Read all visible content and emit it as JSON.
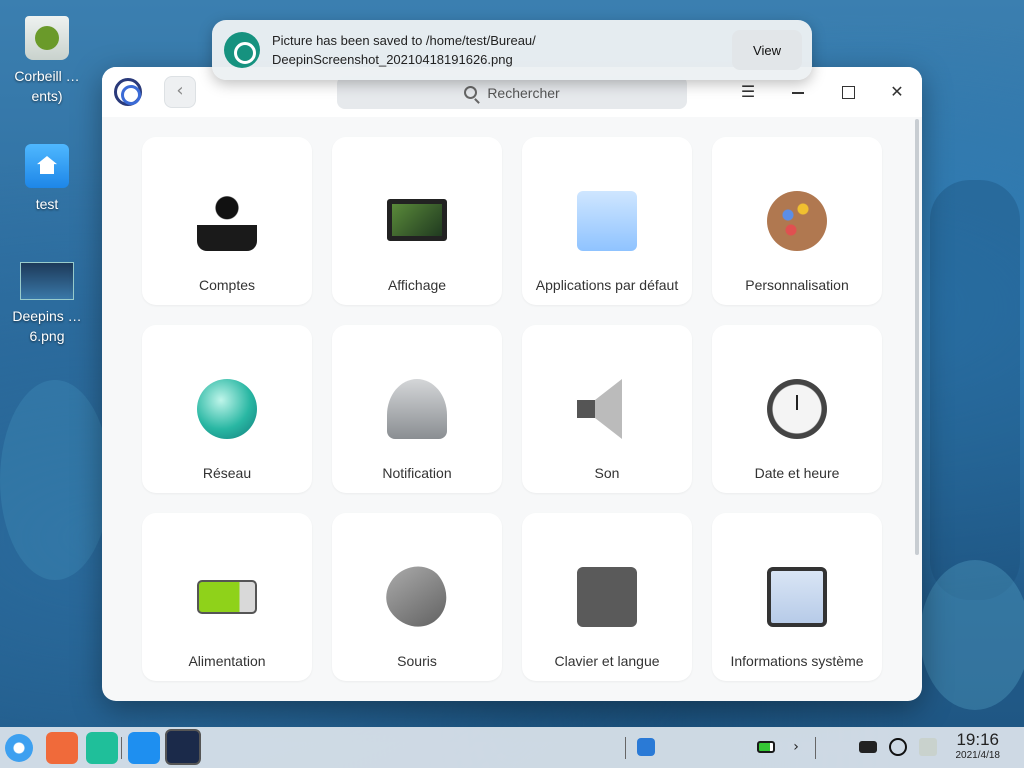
{
  "desktop": {
    "icons": [
      {
        "label": "Corbeill …ents)"
      },
      {
        "label": "test"
      },
      {
        "label": "Deepins …6.png"
      }
    ]
  },
  "notification": {
    "message_line1": "Picture has been saved to /home/test/Bureau/",
    "message_line2": "DeepinScreenshot_20210418191626.png",
    "button": "View"
  },
  "window": {
    "search_placeholder": "Rechercher",
    "back_glyph": "‹",
    "menu_glyph": "☰",
    "close_glyph": "✕",
    "modules": [
      {
        "label": "Comptes",
        "icon": "accounts-icon"
      },
      {
        "label": "Affichage",
        "icon": "display-icon"
      },
      {
        "label": "Applications par défaut",
        "icon": "default-apps-icon"
      },
      {
        "label": "Personnalisation",
        "icon": "personalization-icon"
      },
      {
        "label": "Réseau",
        "icon": "network-icon"
      },
      {
        "label": "Notification",
        "icon": "notification-bell-icon"
      },
      {
        "label": "Son",
        "icon": "speaker-icon"
      },
      {
        "label": "Date et heure",
        "icon": "clock-icon"
      },
      {
        "label": "Alimentation",
        "icon": "battery-icon"
      },
      {
        "label": "Souris",
        "icon": "mouse-icon"
      },
      {
        "label": "Clavier et langue",
        "icon": "keyboard-icon"
      },
      {
        "label": "Informations système",
        "icon": "system-info-icon"
      }
    ]
  },
  "dock": {
    "tray_arrow": "›",
    "time": "19:16",
    "date": "2021/4/18"
  }
}
